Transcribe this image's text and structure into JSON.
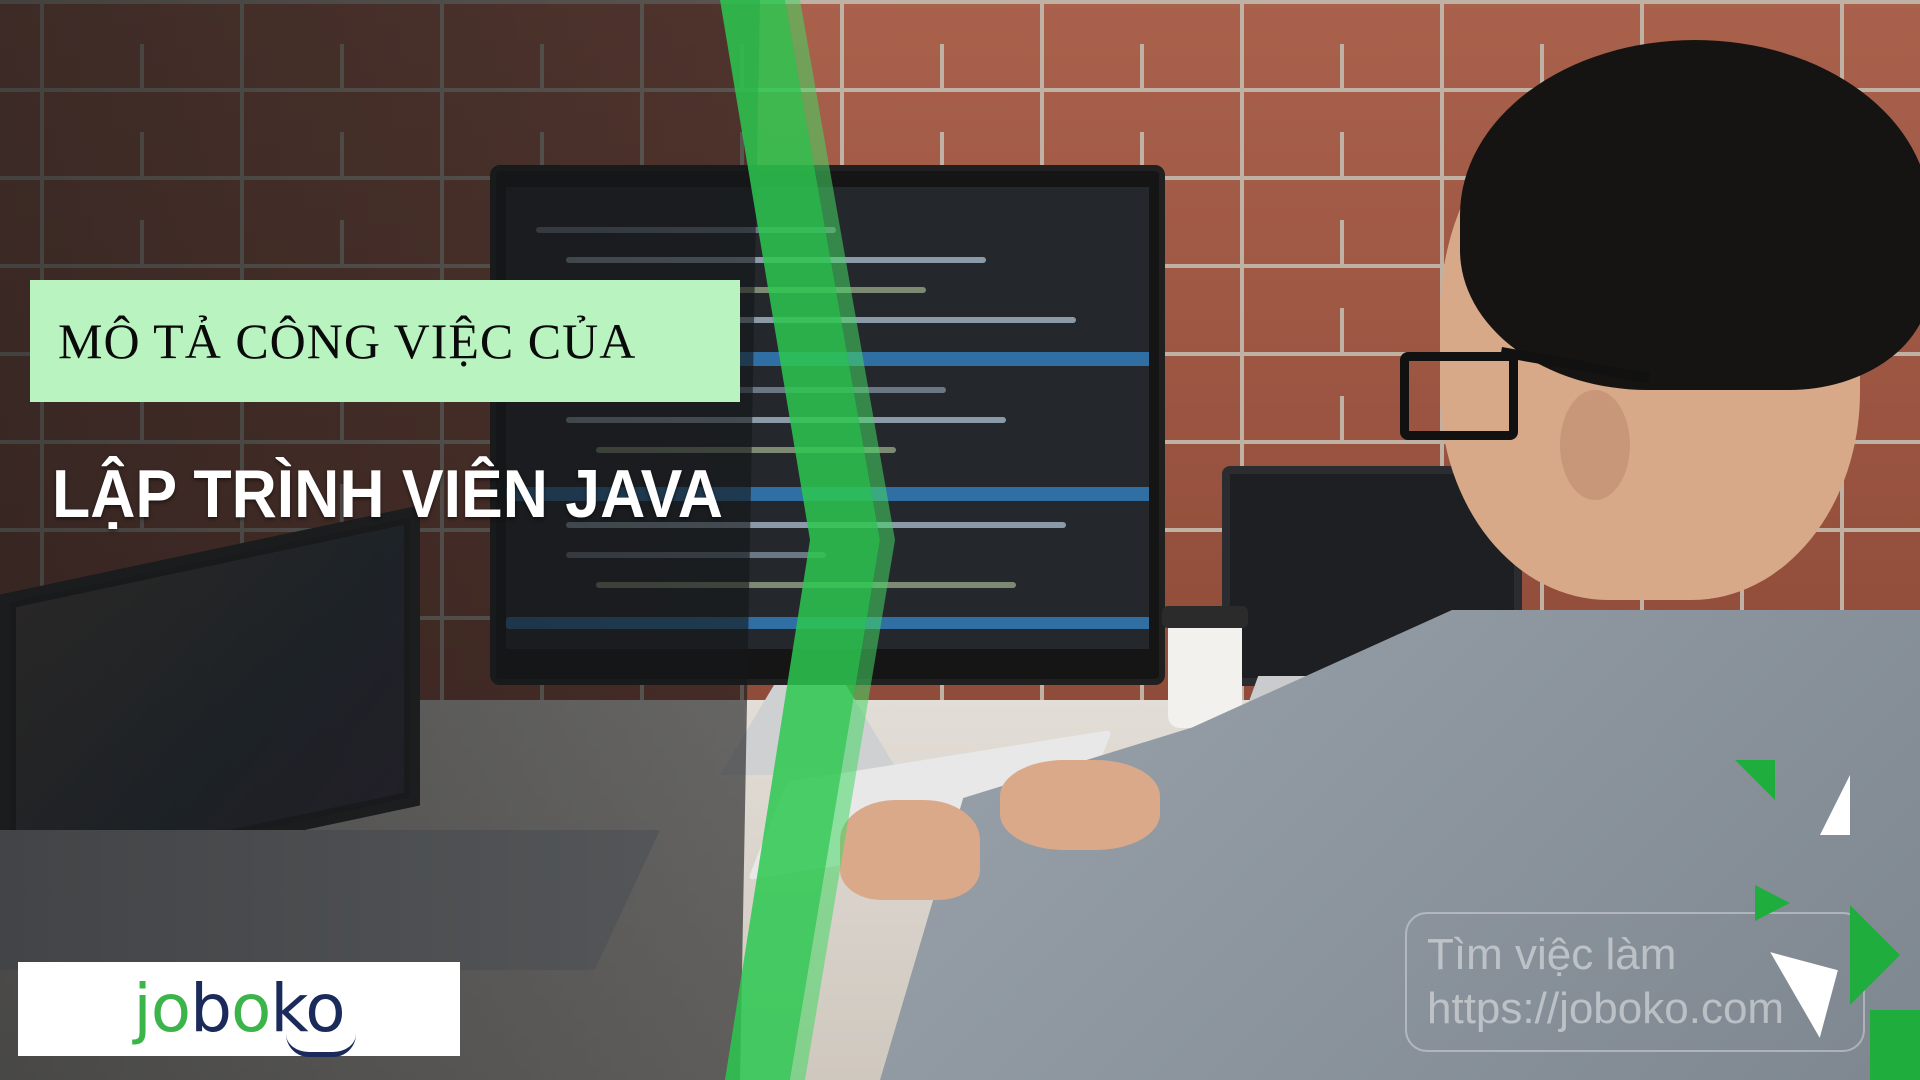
{
  "headline": {
    "subtitle": "MÔ TẢ CÔNG VIỆC CỦA",
    "title": "LẬP TRÌNH VIÊN JAVA"
  },
  "logo": {
    "part1": "jo",
    "part2": "b",
    "part3": "o",
    "part4": "ko"
  },
  "watermark": {
    "line1": "Tìm việc làm",
    "line2": "https://joboko.com"
  },
  "colors": {
    "accent_green": "#2cc850",
    "subtitle_box": "#b8f3c0",
    "logo_green": "#3bb54a",
    "logo_navy": "#1a2a5a"
  }
}
